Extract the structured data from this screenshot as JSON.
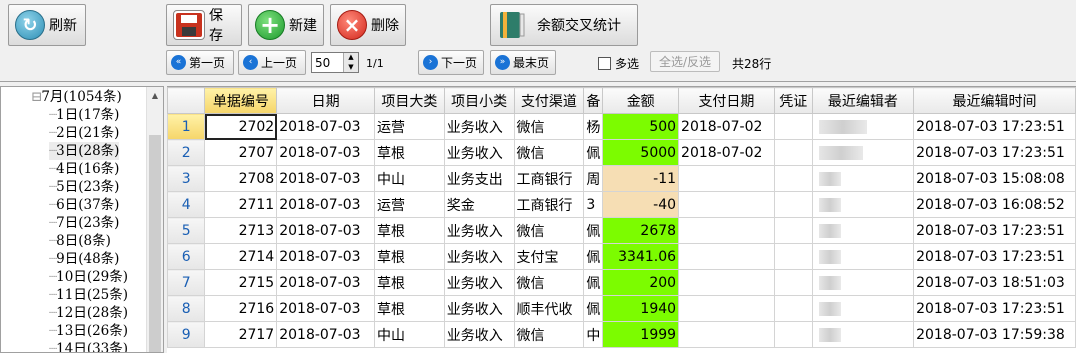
{
  "toolbar": {
    "refresh_label": "刷新",
    "save_label": "保存",
    "add_label": "新建",
    "delete_label": "删除",
    "stats_label": "余额交叉统计",
    "first_label": "第一页",
    "prev_label": "上一页",
    "page_size": "50",
    "page_info": "1/1",
    "next_label": "下一页",
    "last_label": "最末页",
    "multi_select_label": "多选",
    "select_toggle_label": "全选/反选",
    "total_label": "共28行"
  },
  "tree": {
    "month": "7月(1054条)",
    "days": [
      "1日(17条)",
      "2日(21条)",
      "3日(28条)",
      "4日(16条)",
      "5日(23条)",
      "6日(37条)",
      "7日(23条)",
      "8日(8条)",
      "9日(48条)",
      "10日(29条)",
      "11日(25条)",
      "12日(28条)",
      "13日(26条)",
      "14日(33条)"
    ]
  },
  "grid": {
    "columns": [
      "单据编号",
      "日期",
      "项目大类",
      "项目小类",
      "支付渠道",
      "备",
      "金额",
      "支付日期",
      "凭证",
      "最近编辑者",
      "最近编辑时间"
    ],
    "rows": [
      {
        "n": "1",
        "id": "2702",
        "date": "2018-07-03",
        "cat": "运营",
        "sub": "业务收入",
        "ch": "微信",
        "note": "杨",
        "amt": "500",
        "pay": "2018-07-02",
        "voucher": "",
        "editor": "",
        "time": "2018-07-03 17:23:51",
        "hl": "green"
      },
      {
        "n": "2",
        "id": "2707",
        "date": "2018-07-03",
        "cat": "草根",
        "sub": "业务收入",
        "ch": "微信",
        "note": "佩",
        "amt": "5000",
        "pay": "2018-07-02",
        "voucher": "",
        "editor": "",
        "time": "2018-07-03 17:23:51",
        "hl": "green"
      },
      {
        "n": "3",
        "id": "2708",
        "date": "2018-07-03",
        "cat": "中山",
        "sub": "业务支出",
        "ch": "工商银行",
        "note": "周",
        "amt": "-11",
        "pay": "",
        "voucher": "",
        "editor": "",
        "time": "2018-07-03 15:08:08",
        "hl": "peach"
      },
      {
        "n": "4",
        "id": "2711",
        "date": "2018-07-03",
        "cat": "运营",
        "sub": "奖金",
        "ch": "工商银行",
        "note": "3",
        "amt": "-40",
        "pay": "",
        "voucher": "",
        "editor": "",
        "time": "2018-07-03 16:08:52",
        "hl": "peach"
      },
      {
        "n": "5",
        "id": "2713",
        "date": "2018-07-03",
        "cat": "草根",
        "sub": "业务收入",
        "ch": "微信",
        "note": "佩",
        "amt": "2678",
        "pay": "",
        "voucher": "",
        "editor": "",
        "time": "2018-07-03 17:23:51",
        "hl": "green"
      },
      {
        "n": "6",
        "id": "2714",
        "date": "2018-07-03",
        "cat": "草根",
        "sub": "业务收入",
        "ch": "支付宝",
        "note": "佩",
        "amt": "3341.06",
        "pay": "",
        "voucher": "",
        "editor": "",
        "time": "2018-07-03 17:23:51",
        "hl": "green"
      },
      {
        "n": "7",
        "id": "2715",
        "date": "2018-07-03",
        "cat": "草根",
        "sub": "业务收入",
        "ch": "微信",
        "note": "佩",
        "amt": "200",
        "pay": "",
        "voucher": "",
        "editor": "",
        "time": "2018-07-03 18:51:03",
        "hl": "green"
      },
      {
        "n": "8",
        "id": "2716",
        "date": "2018-07-03",
        "cat": "草根",
        "sub": "业务收入",
        "ch": "顺丰代收",
        "note": "佩",
        "amt": "1940",
        "pay": "",
        "voucher": "",
        "editor": "",
        "time": "2018-07-03 17:23:51",
        "hl": "green"
      },
      {
        "n": "9",
        "id": "2717",
        "date": "2018-07-03",
        "cat": "中山",
        "sub": "业务收入",
        "ch": "微信",
        "note": "中",
        "amt": "1999",
        "pay": "",
        "voucher": "",
        "editor": "",
        "time": "2018-07-03 17:59:38",
        "hl": "green"
      }
    ]
  },
  "colors": {
    "positive": "#7cfc00",
    "negative": "#f6deb4",
    "header_active": "#f5d56a"
  }
}
